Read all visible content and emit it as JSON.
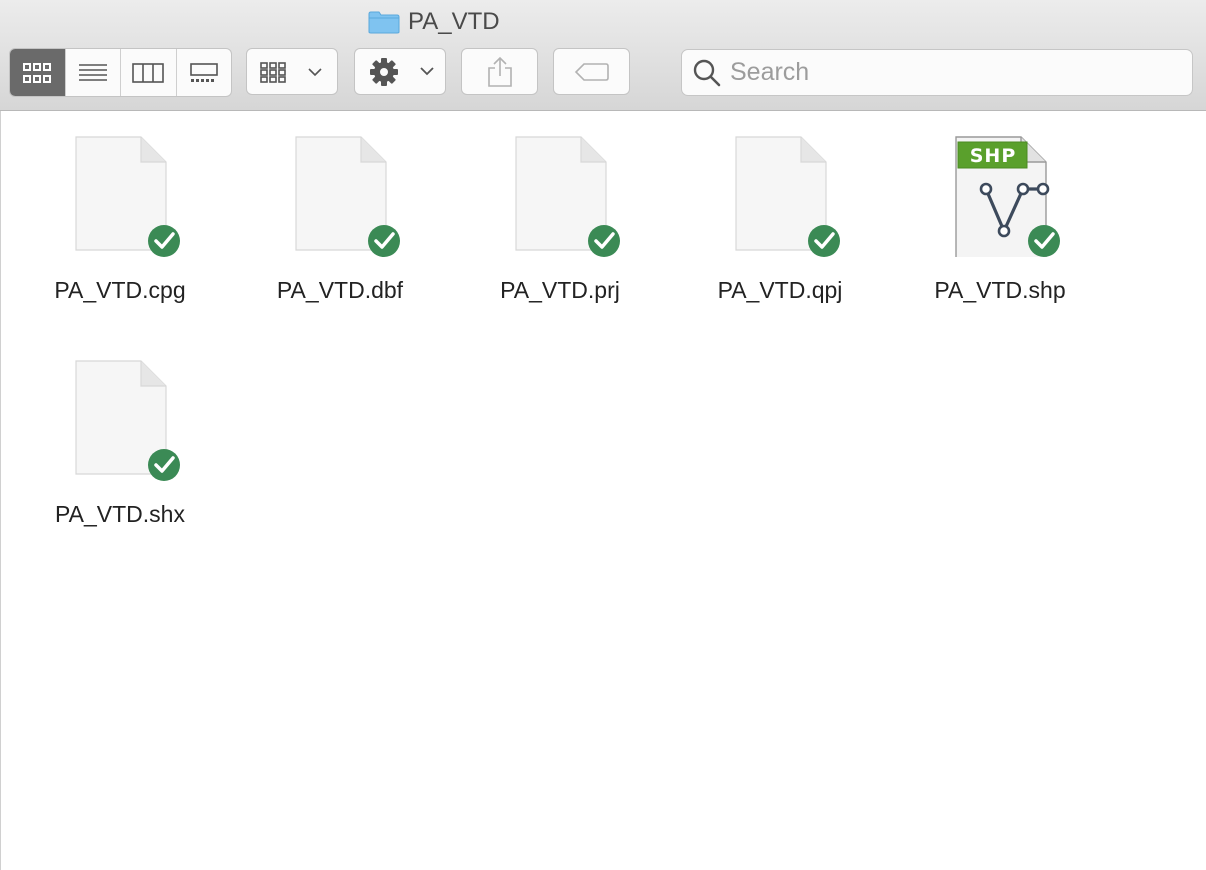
{
  "window": {
    "title": "PA_VTD"
  },
  "toolbar": {
    "view_modes": [
      {
        "name": "icon-view",
        "active": true
      },
      {
        "name": "list-view",
        "active": false
      },
      {
        "name": "column-view",
        "active": false
      },
      {
        "name": "gallery-view",
        "active": false
      }
    ],
    "group_icon": "grid-dropdown-icon",
    "action_icon": "gear-icon",
    "share_icon": "share-icon",
    "tag_icon": "tag-icon"
  },
  "search": {
    "placeholder": "Search",
    "value": ""
  },
  "files": [
    {
      "name": "PA_VTD.cpg",
      "type": "generic",
      "synced": true
    },
    {
      "name": "PA_VTD.dbf",
      "type": "generic",
      "synced": true
    },
    {
      "name": "PA_VTD.prj",
      "type": "generic",
      "synced": true
    },
    {
      "name": "PA_VTD.qpj",
      "type": "generic",
      "synced": true
    },
    {
      "name": "PA_VTD.shp",
      "type": "shapefile",
      "badge": "SHP",
      "synced": true
    },
    {
      "name": "PA_VTD.shx",
      "type": "generic",
      "synced": true
    }
  ],
  "colors": {
    "badge_green": "#5aa02c",
    "check_green": "#3b8a55",
    "folder_blue": "#7fc3f0"
  }
}
